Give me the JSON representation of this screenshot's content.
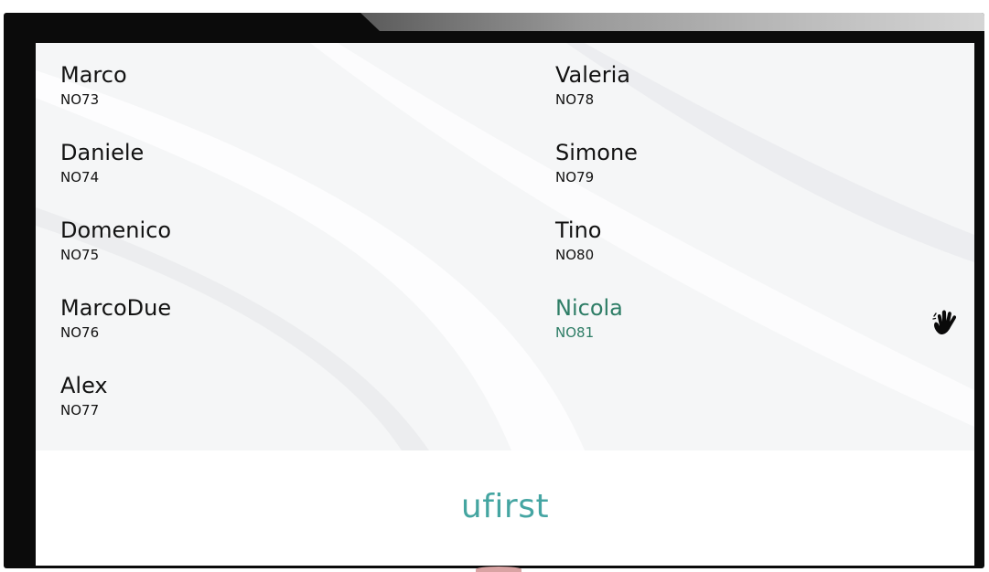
{
  "brand": {
    "logo_text": "ufirst"
  },
  "queue": {
    "left_column": [
      {
        "name": "Marco",
        "code": "NO73"
      },
      {
        "name": "Daniele",
        "code": "NO74"
      },
      {
        "name": "Domenico",
        "code": "NO75"
      },
      {
        "name": "MarcoDue",
        "code": "NO76"
      },
      {
        "name": "Alex",
        "code": "NO77"
      }
    ],
    "right_column": [
      {
        "name": "Valeria",
        "code": "NO78"
      },
      {
        "name": "Simone",
        "code": "NO79"
      },
      {
        "name": "Tino",
        "code": "NO80"
      },
      {
        "name": "Nicola",
        "code": "NO81",
        "active": true
      }
    ]
  },
  "icons": {
    "hand": "hand-wave-icon"
  },
  "colors": {
    "active_text": "#2e7d66",
    "text": "#121212",
    "logo_start": "#3fa48b",
    "logo_end": "#4aa6b8"
  }
}
